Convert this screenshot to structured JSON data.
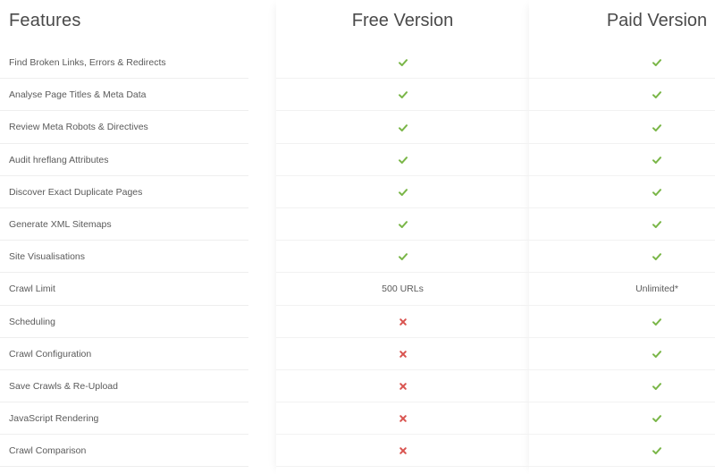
{
  "header": {
    "features": "Features",
    "free": "Free Version",
    "paid": "Paid Version"
  },
  "colors": {
    "check": "#7ab648",
    "cross": "#d9534f",
    "text": "#5a5a5a"
  },
  "rows": [
    {
      "feature": "Find Broken Links, Errors & Redirects",
      "free": {
        "type": "icon",
        "icon": "check-icon"
      },
      "paid": {
        "type": "icon",
        "icon": "check-icon"
      }
    },
    {
      "feature": "Analyse Page Titles & Meta Data",
      "free": {
        "type": "icon",
        "icon": "check-icon"
      },
      "paid": {
        "type": "icon",
        "icon": "check-icon"
      }
    },
    {
      "feature": "Review Meta Robots & Directives",
      "free": {
        "type": "icon",
        "icon": "check-icon"
      },
      "paid": {
        "type": "icon",
        "icon": "check-icon"
      }
    },
    {
      "feature": "Audit hreflang Attributes",
      "free": {
        "type": "icon",
        "icon": "check-icon"
      },
      "paid": {
        "type": "icon",
        "icon": "check-icon"
      }
    },
    {
      "feature": "Discover Exact Duplicate Pages",
      "free": {
        "type": "icon",
        "icon": "check-icon"
      },
      "paid": {
        "type": "icon",
        "icon": "check-icon"
      }
    },
    {
      "feature": "Generate XML Sitemaps",
      "free": {
        "type": "icon",
        "icon": "check-icon"
      },
      "paid": {
        "type": "icon",
        "icon": "check-icon"
      }
    },
    {
      "feature": "Site Visualisations",
      "free": {
        "type": "icon",
        "icon": "check-icon"
      },
      "paid": {
        "type": "icon",
        "icon": "check-icon"
      }
    },
    {
      "feature": "Crawl Limit",
      "free": {
        "type": "text",
        "text": "500 URLs"
      },
      "paid": {
        "type": "text",
        "text": "Unlimited*"
      }
    },
    {
      "feature": "Scheduling",
      "free": {
        "type": "icon",
        "icon": "cross-icon"
      },
      "paid": {
        "type": "icon",
        "icon": "check-icon"
      }
    },
    {
      "feature": "Crawl Configuration",
      "free": {
        "type": "icon",
        "icon": "cross-icon"
      },
      "paid": {
        "type": "icon",
        "icon": "check-icon"
      }
    },
    {
      "feature": "Save Crawls & Re-Upload",
      "free": {
        "type": "icon",
        "icon": "cross-icon"
      },
      "paid": {
        "type": "icon",
        "icon": "check-icon"
      }
    },
    {
      "feature": "JavaScript Rendering",
      "free": {
        "type": "icon",
        "icon": "cross-icon"
      },
      "paid": {
        "type": "icon",
        "icon": "check-icon"
      }
    },
    {
      "feature": "Crawl Comparison",
      "free": {
        "type": "icon",
        "icon": "cross-icon"
      },
      "paid": {
        "type": "icon",
        "icon": "check-icon"
      }
    }
  ]
}
